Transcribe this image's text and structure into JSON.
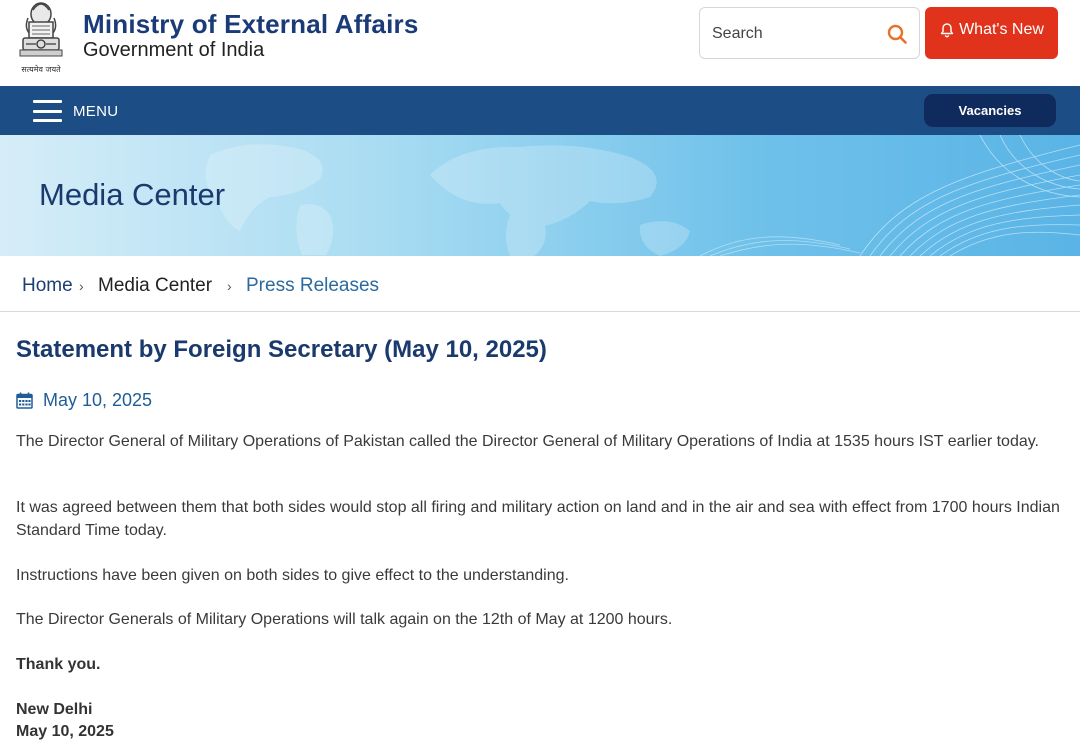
{
  "header": {
    "emblem_caption": "सत्यमेव जयते",
    "title": "Ministry of External Affairs",
    "subtitle": "Government of India",
    "search_placeholder": "Search",
    "whats_new_label": "What's New"
  },
  "nav": {
    "menu_label": "MENU",
    "vacancies_label": "Vacancies"
  },
  "banner": {
    "title": "Media Center"
  },
  "breadcrumb": {
    "home": "Home",
    "sep1": "›",
    "media": "Media Center",
    "sep2": "›",
    "current": "Press Releases"
  },
  "article": {
    "headline": "Statement by Foreign Secretary (May 10, 2025)",
    "date": "May 10, 2025",
    "paragraphs": [
      "The Director General of Military Operations of Pakistan called the Director General of Military Operations of India at 1535 hours IST earlier today.",
      "It was agreed between them that both sides would stop all firing and military action on land and in the air and sea with effect from 1700 hours Indian Standard Time today.",
      "Instructions have been given on both sides to give effect to the understanding.",
      "The Director Generals of Military Operations will talk again on the 12th of May at 1200 hours.",
      "Thank you.",
      "New Delhi",
      "May 10, 2025"
    ]
  },
  "colors": {
    "brand_blue": "#1a3a78",
    "nav_blue": "#1c4e85",
    "whats_new_red": "#e1331b",
    "vacancies_navy": "#0f2a5c",
    "search_icon_orange": "#e8722a"
  },
  "icons": [
    "emblem-logo",
    "search-icon",
    "bell-icon",
    "hamburger-icon",
    "calendar-icon"
  ]
}
